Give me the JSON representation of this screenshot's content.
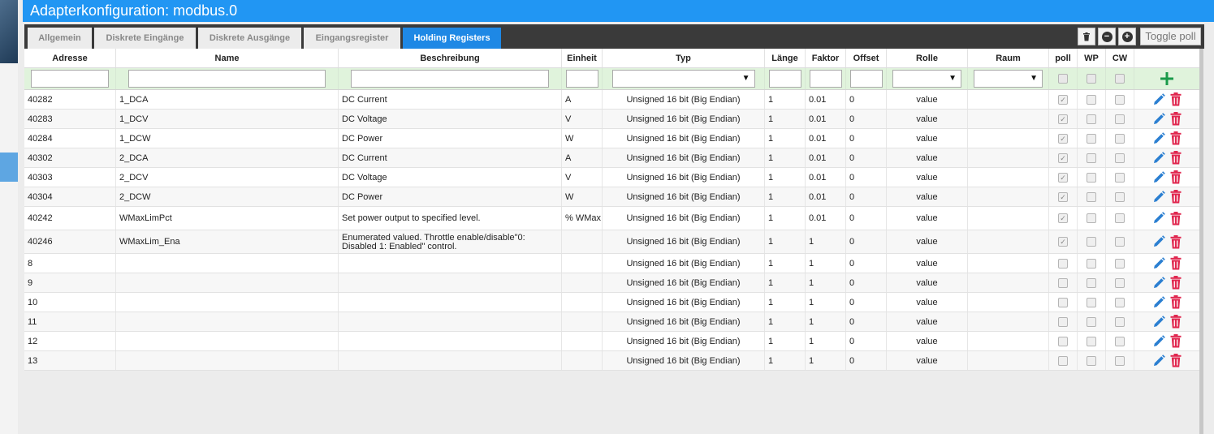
{
  "title": "Adapterkonfiguration: modbus.0",
  "tabs": [
    {
      "label": "Allgemein"
    },
    {
      "label": "Diskrete Eingänge"
    },
    {
      "label": "Diskrete Ausgänge"
    },
    {
      "label": "Eingangsregister"
    },
    {
      "label": "Holding Registers"
    }
  ],
  "active_tab": "Holding Registers",
  "toolbar": {
    "delete_icon": "trash-icon",
    "minus_icon": "minus-circle-icon",
    "plus_icon": "plus-circle-icon",
    "toggle_poll_label": "Toggle poll"
  },
  "columns": [
    "Adresse",
    "Name",
    "Beschreibung",
    "Einheit",
    "Typ",
    "Länge",
    "Faktor",
    "Offset",
    "Rolle",
    "Raum",
    "poll",
    "WP",
    "CW"
  ],
  "filter_row": {
    "select_arrow": "▼",
    "add_icon": "plus-icon"
  },
  "rows": [
    {
      "adresse": "40282",
      "name": "1_DCA",
      "beschreibung": "DC Current",
      "einheit": "A",
      "typ": "Unsigned 16 bit (Big Endian)",
      "laenge": "1",
      "faktor": "0.01",
      "offset": "0",
      "rolle": "value",
      "raum": "",
      "poll": true,
      "wp": false,
      "cw": false
    },
    {
      "adresse": "40283",
      "name": "1_DCV",
      "beschreibung": "DC Voltage",
      "einheit": "V",
      "typ": "Unsigned 16 bit (Big Endian)",
      "laenge": "1",
      "faktor": "0.01",
      "offset": "0",
      "rolle": "value",
      "raum": "",
      "poll": true,
      "wp": false,
      "cw": false
    },
    {
      "adresse": "40284",
      "name": "1_DCW",
      "beschreibung": "DC Power",
      "einheit": "W",
      "typ": "Unsigned 16 bit (Big Endian)",
      "laenge": "1",
      "faktor": "0.01",
      "offset": "0",
      "rolle": "value",
      "raum": "",
      "poll": true,
      "wp": false,
      "cw": false
    },
    {
      "adresse": "40302",
      "name": "2_DCA",
      "beschreibung": "DC Current",
      "einheit": "A",
      "typ": "Unsigned 16 bit (Big Endian)",
      "laenge": "1",
      "faktor": "0.01",
      "offset": "0",
      "rolle": "value",
      "raum": "",
      "poll": true,
      "wp": false,
      "cw": false
    },
    {
      "adresse": "40303",
      "name": "2_DCV",
      "beschreibung": "DC Voltage",
      "einheit": "V",
      "typ": "Unsigned 16 bit (Big Endian)",
      "laenge": "1",
      "faktor": "0.01",
      "offset": "0",
      "rolle": "value",
      "raum": "",
      "poll": true,
      "wp": false,
      "cw": false
    },
    {
      "adresse": "40304",
      "name": "2_DCW",
      "beschreibung": "DC Power",
      "einheit": "W",
      "typ": "Unsigned 16 bit (Big Endian)",
      "laenge": "1",
      "faktor": "0.01",
      "offset": "0",
      "rolle": "value",
      "raum": "",
      "poll": true,
      "wp": false,
      "cw": false
    },
    {
      "adresse": "40242",
      "name": "WMaxLimPct",
      "beschreibung": "Set power output to specified level.",
      "einheit": "% WMax",
      "typ": "Unsigned 16 bit (Big Endian)",
      "laenge": "1",
      "faktor": "0.01",
      "offset": "0",
      "rolle": "value",
      "raum": "",
      "poll": true,
      "wp": false,
      "cw": false,
      "tall": true
    },
    {
      "adresse": "40246",
      "name": "WMaxLim_Ena",
      "beschreibung": "Enumerated valued. Throttle enable/disable\"0: Disabled 1: Enabled\" control.",
      "einheit": "",
      "typ": "Unsigned 16 bit (Big Endian)",
      "laenge": "1",
      "faktor": "1",
      "offset": "0",
      "rolle": "value",
      "raum": "",
      "poll": true,
      "wp": false,
      "cw": false,
      "tall": true
    },
    {
      "adresse": "8",
      "name": "",
      "beschreibung": "",
      "einheit": "",
      "typ": "Unsigned 16 bit (Big Endian)",
      "laenge": "1",
      "faktor": "1",
      "offset": "0",
      "rolle": "value",
      "raum": "",
      "poll": false,
      "wp": false,
      "cw": false
    },
    {
      "adresse": "9",
      "name": "",
      "beschreibung": "",
      "einheit": "",
      "typ": "Unsigned 16 bit (Big Endian)",
      "laenge": "1",
      "faktor": "1",
      "offset": "0",
      "rolle": "value",
      "raum": "",
      "poll": false,
      "wp": false,
      "cw": false
    },
    {
      "adresse": "10",
      "name": "",
      "beschreibung": "",
      "einheit": "",
      "typ": "Unsigned 16 bit (Big Endian)",
      "laenge": "1",
      "faktor": "1",
      "offset": "0",
      "rolle": "value",
      "raum": "",
      "poll": false,
      "wp": false,
      "cw": false
    },
    {
      "adresse": "11",
      "name": "",
      "beschreibung": "",
      "einheit": "",
      "typ": "Unsigned 16 bit (Big Endian)",
      "laenge": "1",
      "faktor": "1",
      "offset": "0",
      "rolle": "value",
      "raum": "",
      "poll": false,
      "wp": false,
      "cw": false
    },
    {
      "adresse": "12",
      "name": "",
      "beschreibung": "",
      "einheit": "",
      "typ": "Unsigned 16 bit (Big Endian)",
      "laenge": "1",
      "faktor": "1",
      "offset": "0",
      "rolle": "value",
      "raum": "",
      "poll": false,
      "wp": false,
      "cw": false
    },
    {
      "adresse": "13",
      "name": "",
      "beschreibung": "",
      "einheit": "",
      "typ": "Unsigned 16 bit (Big Endian)",
      "laenge": "1",
      "faktor": "1",
      "offset": "0",
      "rolle": "value",
      "raum": "",
      "poll": false,
      "wp": false,
      "cw": false
    }
  ],
  "row_action_icons": {
    "edit": "pencil-icon",
    "delete": "trash-icon"
  },
  "colors": {
    "accent": "#2196f3",
    "active_tab": "#1e88e5",
    "filter_bg": "#e0f3dc",
    "edit_icon": "#2b7fd1",
    "delete_icon": "#e0274f",
    "add_icon": "#1a9a4a"
  }
}
